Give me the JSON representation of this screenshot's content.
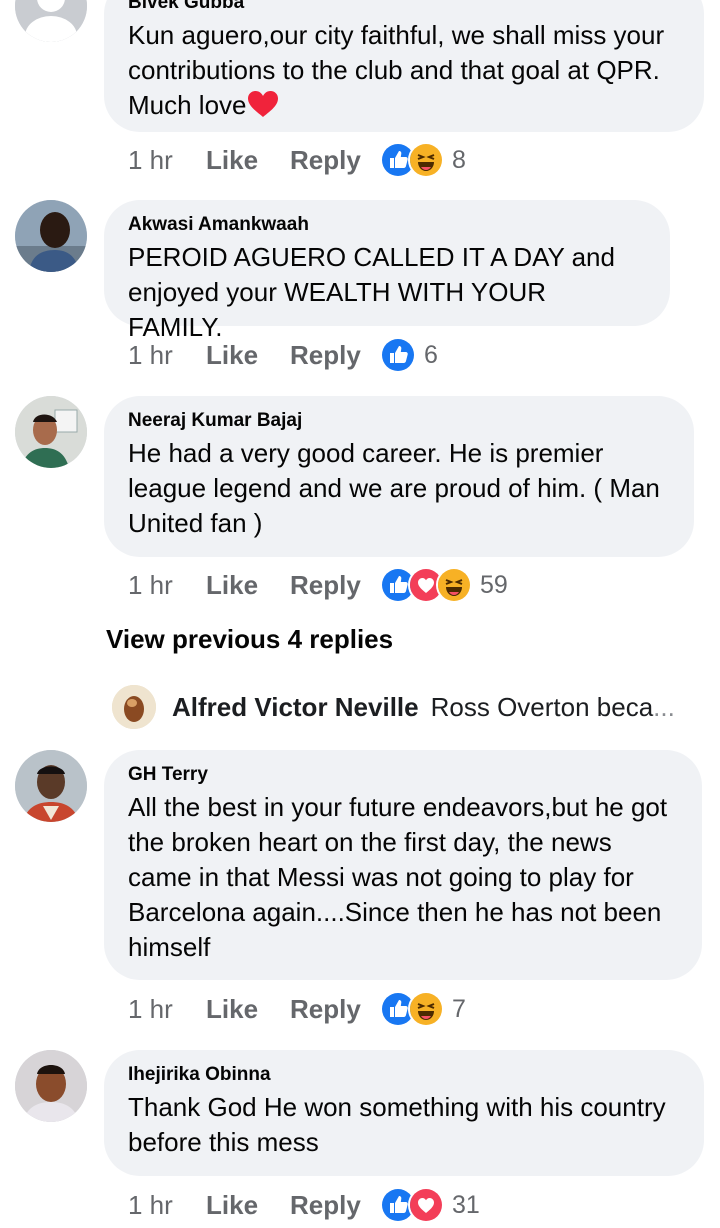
{
  "comments": [
    {
      "author": "Bivek Gubba",
      "text": "Kun aguero,our city faithful, we shall miss your contributions to the club and that goal at QPR. Much love",
      "time": "1 hr",
      "like": "Like",
      "reply": "Reply",
      "reactions": [
        "like",
        "haha"
      ],
      "reaction_count": "8"
    },
    {
      "author": "Akwasi Amankwaah",
      "text": "PEROID AGUERO CALLED IT A DAY and enjoyed your WEALTH WITH YOUR FAMILY.",
      "time": "1 hr",
      "like": "Like",
      "reply": "Reply",
      "reactions": [
        "like"
      ],
      "reaction_count": "6"
    },
    {
      "author": "Neeraj Kumar Bajaj",
      "text": "He had a very good career. He is premier league legend and we are proud of him. ( Man United fan )",
      "time": "1 hr",
      "like": "Like",
      "reply": "Reply",
      "reactions": [
        "like",
        "love",
        "haha"
      ],
      "reaction_count": "59"
    },
    {
      "author": "GH Terry",
      "text": "All the best in your future endeavors,but he got the broken heart on the first day, the news came in that Messi was not going to play for Barcelona again....Since then he has not been himself",
      "time": "1 hr",
      "like": "Like",
      "reply": "Reply",
      "reactions": [
        "like",
        "haha"
      ],
      "reaction_count": "7"
    },
    {
      "author": "Ihejirika Obinna",
      "text": "Thank God He won something with his country before this mess",
      "time": "1 hr",
      "like": "Like",
      "reply": "Reply",
      "reactions": [
        "like",
        "love"
      ],
      "reaction_count": "31"
    }
  ],
  "view_previous": "View previous 4 replies",
  "nested_reply": {
    "author": "Alfred Victor Neville",
    "text": "Ross Overton beca",
    "ellipsis": "..."
  },
  "colors": {
    "bubble": "#f0f2f5",
    "like_blue": "#1877f2",
    "love_red": "#f33e58",
    "haha_yellow": "#f7b125",
    "meta_gray": "#65676b"
  }
}
